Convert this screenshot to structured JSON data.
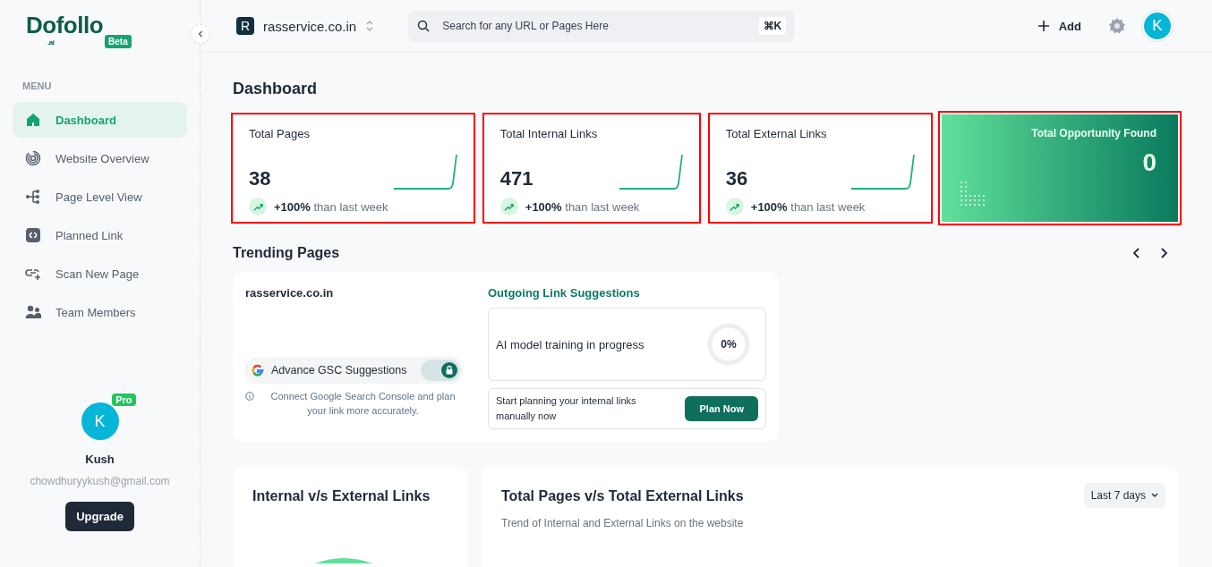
{
  "logo": {
    "name": "Dofollo",
    "suffix": ".ai",
    "badge": "Beta"
  },
  "sidebar": {
    "menu_label": "MENU",
    "items": [
      {
        "label": "Dashboard",
        "selected": true
      },
      {
        "label": "Website Overview",
        "selected": false
      },
      {
        "label": "Page Level View",
        "selected": false
      },
      {
        "label": "Planned Link",
        "selected": false
      },
      {
        "label": "Scan New Page",
        "selected": false
      },
      {
        "label": "Team Members",
        "selected": false
      }
    ],
    "user": {
      "initial": "K",
      "badge": "Pro",
      "name": "Kush",
      "email": "chowdhuryykush@gmail.com",
      "button": "Upgrade"
    }
  },
  "header": {
    "site_initial": "R",
    "site": "rasservice.co.in",
    "search": {
      "placeholder": "Search for any URL or Pages Here",
      "shortcut": "⌘K"
    },
    "add": "Add",
    "avatar": "K"
  },
  "page_title": "Dashboard",
  "stats": [
    {
      "kind": "metric",
      "title": "Total Pages",
      "value": "38",
      "change": "+100%",
      "change_text": "than last week",
      "highlighted": true
    },
    {
      "kind": "metric",
      "title": "Total Internal Links",
      "value": "471",
      "change": "+100%",
      "change_text": "than last week",
      "highlighted": true
    },
    {
      "kind": "metric",
      "title": "Total External Links",
      "value": "36",
      "change": "+100%",
      "change_text": "than last week",
      "highlighted": true
    },
    {
      "kind": "opportunity",
      "title": "Total Opportunity Found",
      "value": "0",
      "highlighted": true
    }
  ],
  "trending": {
    "title": "Trending Pages",
    "site": "rasservice.co.in",
    "gsc_label": "Advance GSC Suggestions",
    "gsc_locked": true,
    "gsc_note": "Connect Google Search Console and plan your link more accurately.",
    "suggestions": {
      "title": "Outgoing Link Suggestions",
      "training": "AI model training in progress",
      "progress": "0%",
      "plan_text": "Start planning your internal links manually now",
      "plan_button": "Plan Now"
    }
  },
  "bottom": [
    {
      "title": "Internal v/s External Links"
    },
    {
      "title": "Total Pages v/s Total External Links",
      "subtitle": "Trend of Internal and External Links on the website",
      "range": "Last 7 days"
    }
  ]
}
